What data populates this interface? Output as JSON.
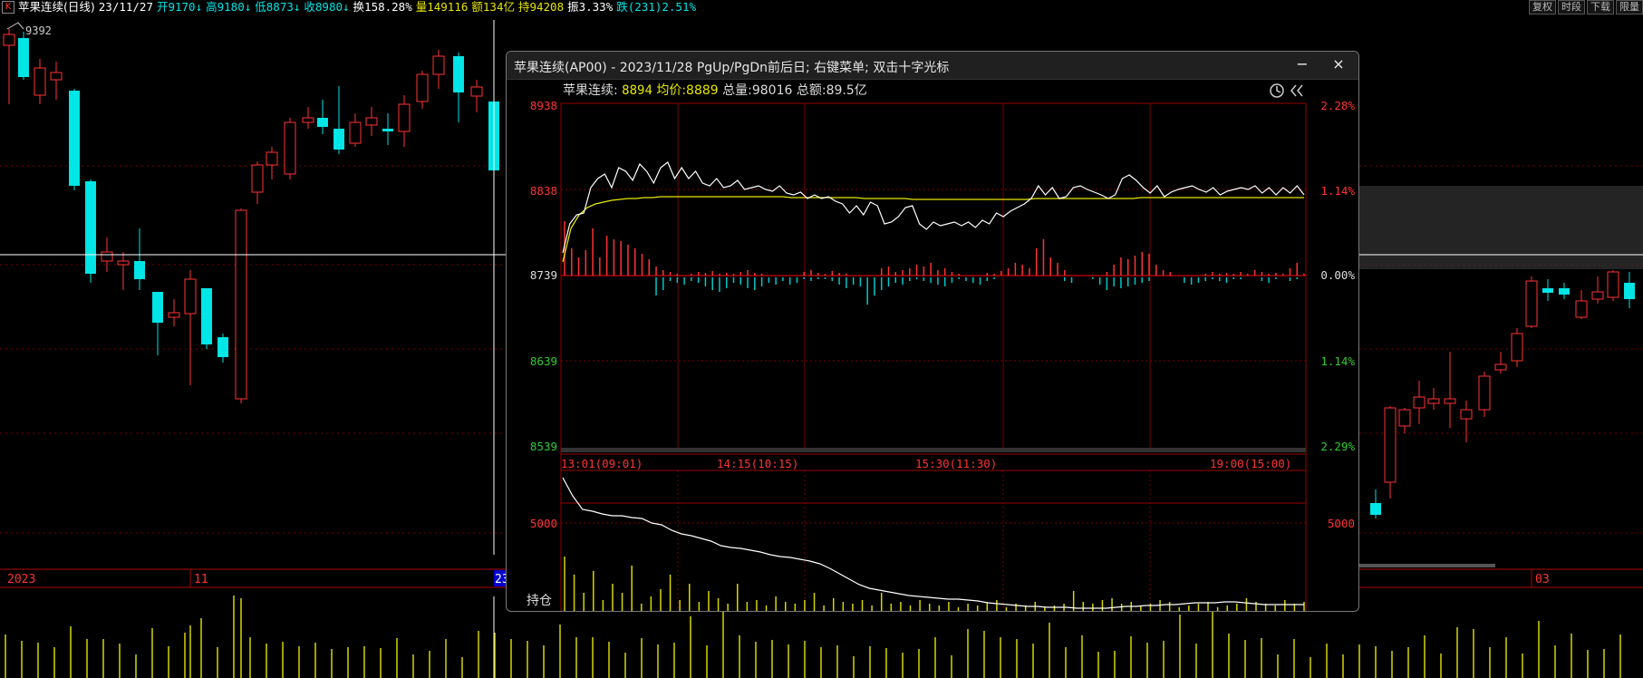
{
  "topbar": {
    "k_icon": "K",
    "name": "苹果连续(日线)",
    "date": "23/11/27",
    "open": "开9170↓",
    "high": "高9180↓",
    "low": "低8873↓",
    "close": "收8980↓",
    "turnover": "换158.28%",
    "volume": "量149116",
    "amount": "额134亿",
    "position": "持94208",
    "amplitude": "振3.33%",
    "change": "跌(231)2.51%"
  },
  "corner_buttons": [
    "复权",
    "时段",
    "下载",
    "限量"
  ],
  "main_chart": {
    "peak_label": "9392",
    "date_axis": [
      "2023",
      "11",
      "23",
      "03"
    ]
  },
  "popup": {
    "title": "苹果连续(AP00) - 2023/11/28 PgUp/PgDn前后日; 右键菜单; 双击十字光标",
    "minimize_label": "−",
    "close_label": "×",
    "info": {
      "name": "苹果连续:",
      "price": "8894",
      "avg": "均价:8889",
      "total_vol": "总量:98016",
      "total_amt": "总额:89.5亿"
    },
    "icons": {
      "clock": "clock-icon",
      "collapse": "collapse-icon"
    },
    "price_labels_left": [
      "8938",
      "8838",
      "8739",
      "8639",
      "8539"
    ],
    "pct_labels_right": [
      "2.28%",
      "1.14%",
      "0.00%",
      "1.14%",
      "2.29%"
    ],
    "time_labels": [
      "13:01(09:01)",
      "14:15(10:15)",
      "15:30(11:30)",
      "19:00(15:00)"
    ],
    "oi_label_left": "5000",
    "oi_label_right": "5000",
    "oi_title": "持仓"
  },
  "colors": {
    "up": "#ff3333",
    "down": "#00e5e5",
    "price_line": "#ffffff",
    "avg_line": "#e6e600",
    "grid": "#7a0000",
    "volume_bar": "#d6d600"
  }
}
